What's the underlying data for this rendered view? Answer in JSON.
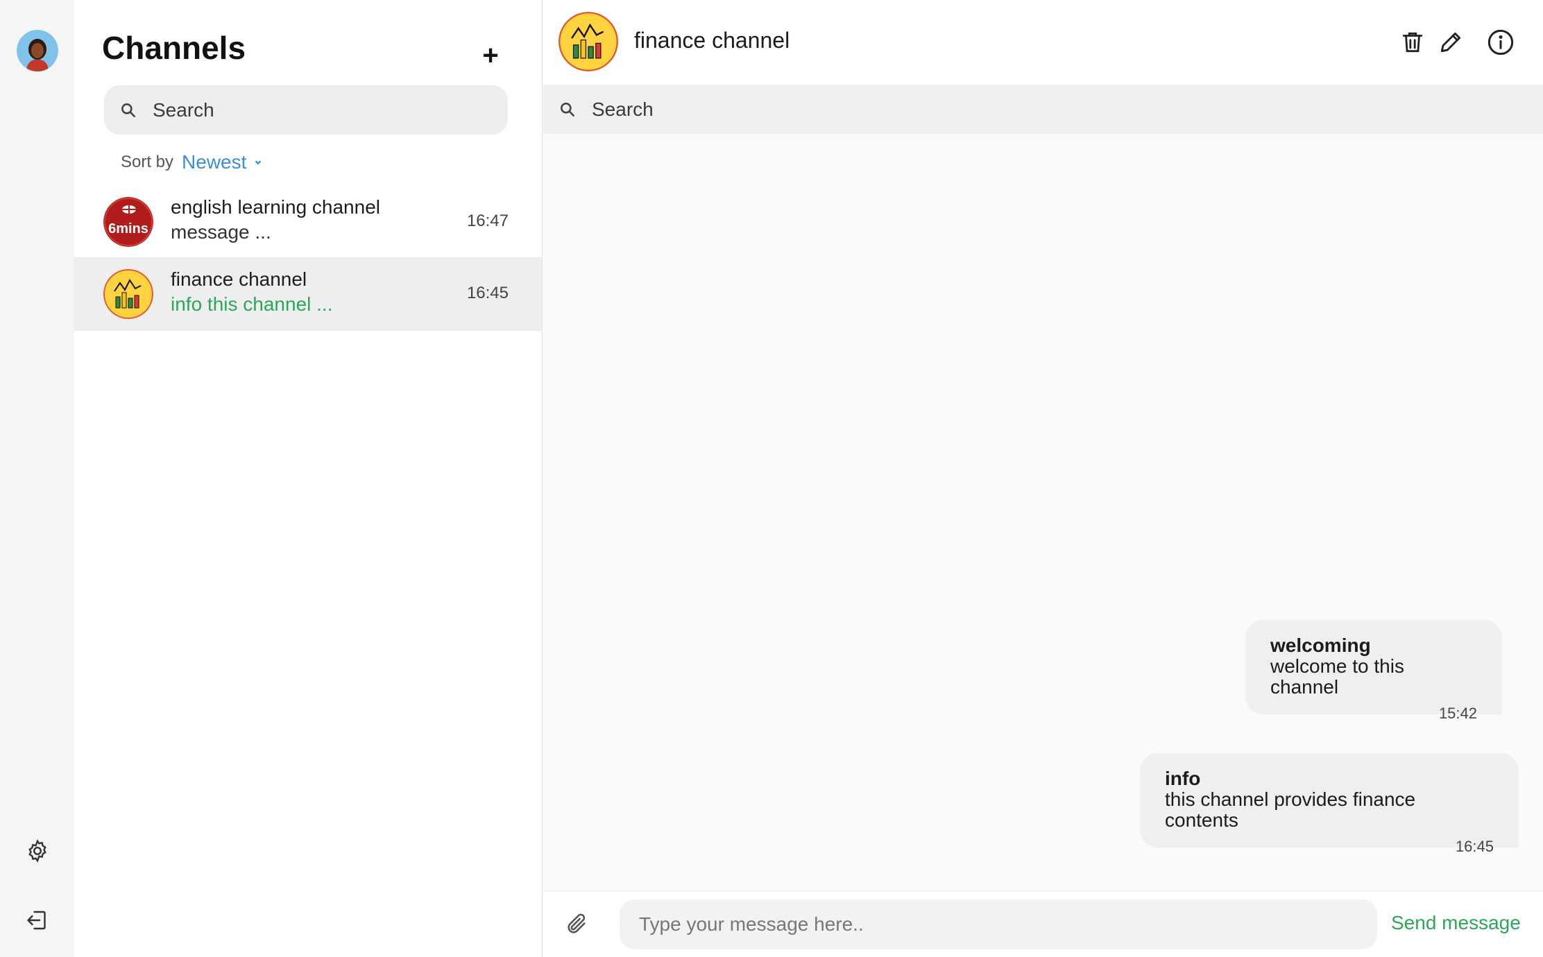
{
  "rail": {
    "icons": [
      "user-avatar",
      "gear-icon",
      "logout-icon"
    ]
  },
  "channels_panel": {
    "title": "Channels",
    "add_label": "+",
    "search_placeholder": "Search",
    "sort_label": "Sort by",
    "sort_value": "Newest",
    "items": [
      {
        "name": "english learning channel",
        "preview": "message ...",
        "time": "16:47",
        "avatar_text": "6mins",
        "active": false
      },
      {
        "name": "finance channel",
        "preview": "info  this channel ...",
        "time": "16:45",
        "active": true
      }
    ]
  },
  "chat": {
    "title": "finance channel",
    "search_placeholder": "Search",
    "messages": [
      {
        "title": "welcoming",
        "text": "welcome to this channel",
        "time": "15:42"
      },
      {
        "title": "info",
        "text": "this channel provides finance contents",
        "time": "16:45"
      }
    ],
    "composer_placeholder": "Type your message here..",
    "send_label": "Send message"
  },
  "colors": {
    "accent_blue": "#3a8fd8",
    "accent_green": "#2aa75a",
    "finance_avatar_bg": "#ffd23f",
    "english_avatar_bg": "#b01c1c"
  }
}
